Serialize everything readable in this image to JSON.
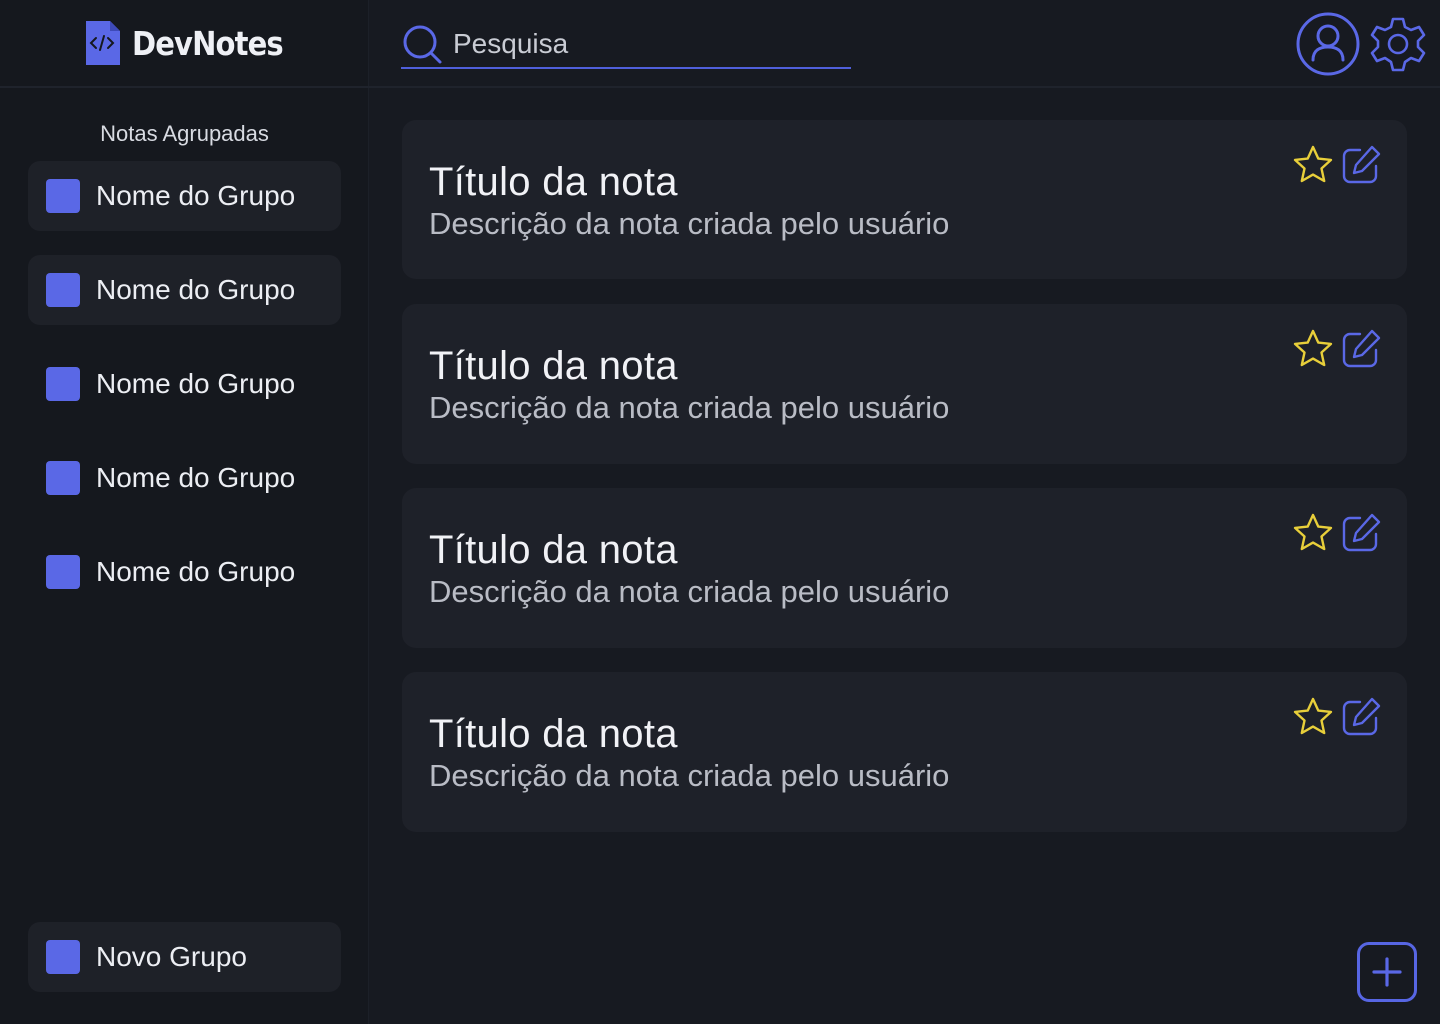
{
  "app": {
    "name": "DevNotes"
  },
  "search": {
    "placeholder": "Pesquisa",
    "value": ""
  },
  "sidebar": {
    "title": "Notas Agrupadas",
    "groups": [
      {
        "label": "Nome do Grupo",
        "color": "#5a68e6"
      },
      {
        "label": "Nome do Grupo",
        "color": "#5a68e6"
      },
      {
        "label": "Nome do Grupo",
        "color": "#5a68e6"
      },
      {
        "label": "Nome do Grupo",
        "color": "#5a68e6"
      },
      {
        "label": "Nome do Grupo",
        "color": "#5a68e6"
      }
    ],
    "new_group_label": "Novo Grupo"
  },
  "notes": [
    {
      "title": "Título da nota",
      "description": "Descrição da nota criada pelo usuário",
      "icons": [
        "star-icon",
        "edit-icon"
      ]
    },
    {
      "title": "Título da nota",
      "description": "Descrição da nota criada pelo usuário",
      "icons": [
        "star-icon",
        "edit-icon"
      ]
    },
    {
      "title": "Título da nota",
      "description": "Descrição da nota criada pelo usuário",
      "icons": [
        "star-icon",
        "edit-icon"
      ]
    },
    {
      "title": "Título da nota",
      "description": "Descrição da nota criada pelo usuário",
      "icons": [
        "star-icon",
        "edit-icon"
      ]
    }
  ],
  "colors": {
    "accent": "#5a68e6",
    "star": "#e8cf3a",
    "background": "#171a21",
    "card": "#1e2129"
  },
  "icons": {
    "logo": "code-file-icon",
    "search": "search-icon",
    "user": "user-avatar-icon",
    "settings": "gear-icon",
    "add": "plus-icon"
  }
}
